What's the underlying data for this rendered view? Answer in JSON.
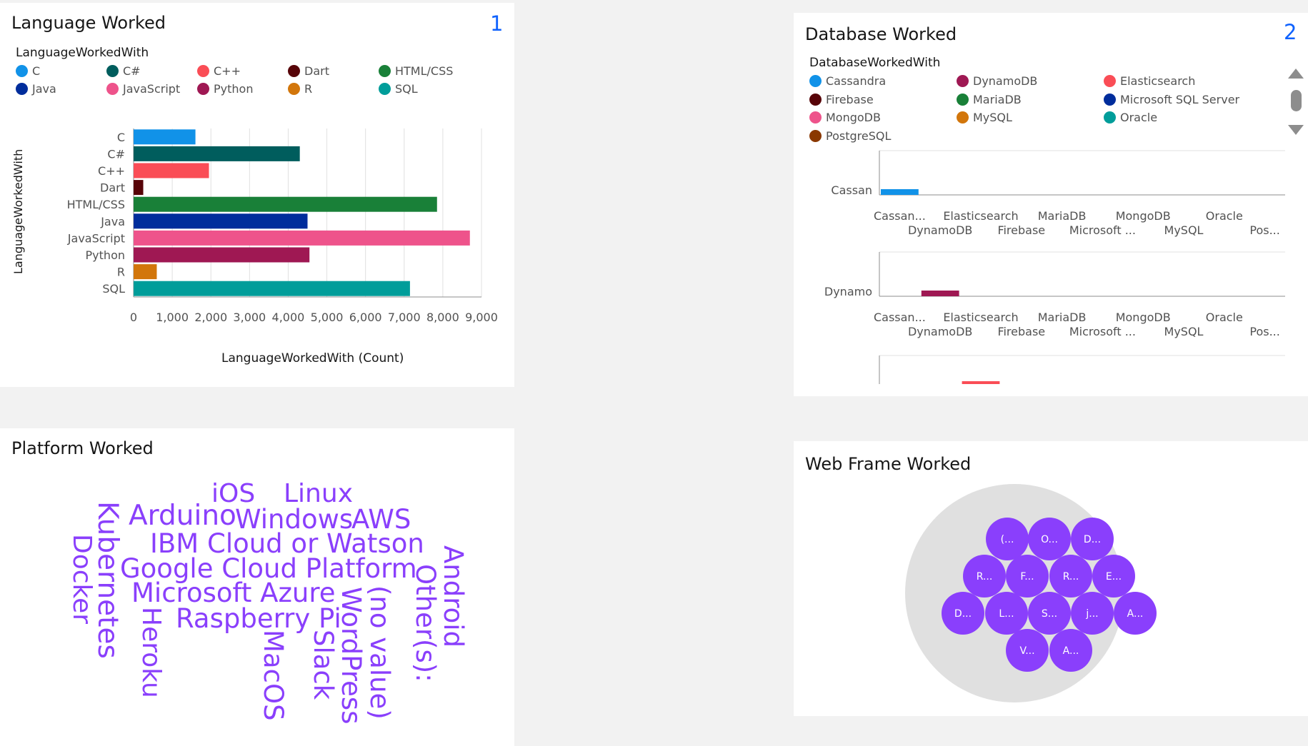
{
  "panels": {
    "lang": {
      "title": "Language Worked",
      "number": "1"
    },
    "db": {
      "title": "Database Worked",
      "number": "2"
    },
    "platform": {
      "title": "Platform Worked"
    },
    "web": {
      "title": "Web Frame Worked"
    }
  },
  "lang_chart": {
    "legend_title": "LanguageWorkedWith",
    "ylabel": "LanguageWorkedWith",
    "xlabel": "LanguageWorkedWith (Count)",
    "legend": [
      {
        "name": "C",
        "color": "#1192e8"
      },
      {
        "name": "C#",
        "color": "#005d5d"
      },
      {
        "name": "C++",
        "color": "#fa4d56"
      },
      {
        "name": "Dart",
        "color": "#570408"
      },
      {
        "name": "HTML/CSS",
        "color": "#198038"
      },
      {
        "name": "Java",
        "color": "#002d9c"
      },
      {
        "name": "JavaScript",
        "color": "#ee538b"
      },
      {
        "name": "Python",
        "color": "#9f1853"
      },
      {
        "name": "R",
        "color": "#d2760b"
      },
      {
        "name": "SQL",
        "color": "#009d9a"
      }
    ]
  },
  "chart_data": [
    {
      "type": "bar",
      "orientation": "horizontal",
      "categories": [
        "C",
        "C#",
        "C++",
        "Dart",
        "HTML/CSS",
        "Java",
        "JavaScript",
        "Python",
        "R",
        "SQL"
      ],
      "values": [
        1600,
        4300,
        1950,
        250,
        7850,
        4500,
        8700,
        4550,
        600,
        7150
      ],
      "colors": [
        "#1192e8",
        "#005d5d",
        "#fa4d56",
        "#570408",
        "#198038",
        "#002d9c",
        "#ee538b",
        "#9f1853",
        "#d2760b",
        "#009d9a"
      ],
      "xlim": [
        0,
        9000
      ],
      "xticks": [
        "0",
        "1,000",
        "2,000",
        "3,000",
        "4,000",
        "5,000",
        "6,000",
        "7,000",
        "8,000",
        "9,000"
      ],
      "xlabel": "LanguageWorkedWith (Count)",
      "ylabel": "LanguageWorkedWith",
      "grid": true,
      "legend": "top"
    },
    {
      "type": "bar",
      "small_multiples": [
        {
          "label": "Cassan",
          "color": "#1192e8",
          "bar_index": 0
        },
        {
          "label": "Dynamo",
          "color": "#9f1853",
          "bar_index": 1
        },
        {
          "label": "",
          "color": "#fa4d56",
          "bar_index": 2
        }
      ],
      "categories": [
        "Cassan...",
        "DynamoDB",
        "Elasticsearch",
        "Firebase",
        "MariaDB",
        "Microsoft ...",
        "MongoDB",
        "MySQL",
        "Oracle",
        "Pos..."
      ],
      "legend": "top"
    }
  ],
  "db_chart": {
    "legend_title": "DatabaseWorkedWith",
    "legend": [
      {
        "name": "Cassandra",
        "color": "#1192e8"
      },
      {
        "name": "DynamoDB",
        "color": "#9f1853"
      },
      {
        "name": "Elasticsearch",
        "color": "#fa4d56"
      },
      {
        "name": "Firebase",
        "color": "#570408"
      },
      {
        "name": "MariaDB",
        "color": "#198038"
      },
      {
        "name": "Microsoft SQL Server",
        "color": "#002d9c"
      },
      {
        "name": "MongoDB",
        "color": "#ee538b"
      },
      {
        "name": "MySQL",
        "color": "#d2760b"
      },
      {
        "name": "Oracle",
        "color": "#009d9a"
      },
      {
        "name": "PostgreSQL",
        "color": "#8a3800"
      }
    ],
    "xticks_top": [
      "Cassan...",
      "Elasticsearch",
      "MariaDB",
      "MongoDB",
      "Oracle"
    ],
    "xticks_bottom": [
      "DynamoDB",
      "Firebase",
      "Microsoft ...",
      "MySQL",
      "Pos..."
    ]
  },
  "platform_cloud": {
    "color": "#8a3ffc",
    "words": [
      "iOS",
      "Linux",
      "Arduino",
      "Windows",
      "AWS",
      "IBM Cloud or Watson",
      "Google Cloud Platform",
      "Microsoft Azure",
      "Raspberry Pi",
      "Kubernetes",
      "Docker",
      "Heroku",
      "MacOS",
      "Slack",
      "WordPress",
      "(no value)",
      "Other(s):",
      "Android"
    ]
  },
  "web_bubbles": {
    "labels": [
      "(...",
      "O...",
      "D...",
      "R...",
      "F...",
      "R...",
      "E...",
      "D...",
      "L...",
      "S...",
      "j...",
      "A...",
      "V...",
      "A..."
    ],
    "bubble_color": "#8a3ffc",
    "pack_color": "#e0e0e0"
  }
}
